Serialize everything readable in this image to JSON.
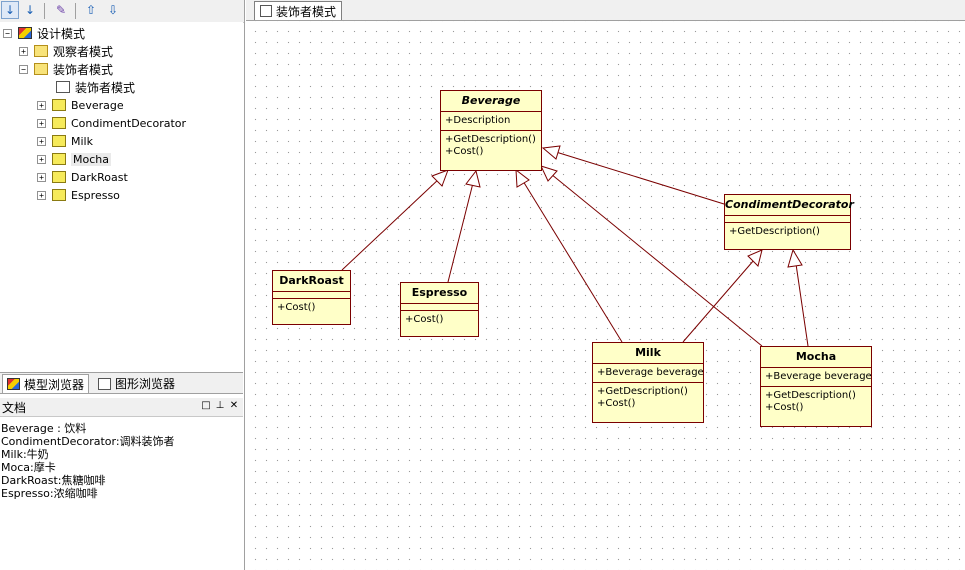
{
  "toolbar": {
    "buttons": [
      "sort-asc-icon",
      "sort-desc-icon",
      "wand-icon",
      "arrow-up-icon",
      "arrow-down-icon"
    ]
  },
  "tree": [
    {
      "label": "设计模式",
      "icon": "model-icon",
      "expander": "−"
    },
    {
      "label": "观察者模式",
      "icon": "package-icon",
      "expander": "+"
    },
    {
      "label": "装饰者模式",
      "icon": "folder-icon",
      "expander": "−"
    },
    {
      "label": "装饰者模式",
      "icon": "diagram-icon",
      "expander": ""
    },
    {
      "label": "Beverage",
      "icon": "class-icon",
      "expander": "+"
    },
    {
      "label": "CondimentDecorator",
      "icon": "class-icon",
      "expander": "+"
    },
    {
      "label": "Milk",
      "icon": "class-icon",
      "expander": "+"
    },
    {
      "label": "Mocha",
      "icon": "class-icon",
      "expander": "+"
    },
    {
      "label": "DarkRoast",
      "icon": "class-icon",
      "expander": "+"
    },
    {
      "label": "Espresso",
      "icon": "class-icon",
      "expander": "+"
    }
  ],
  "left_tabs": [
    {
      "label": "模型浏览器"
    },
    {
      "label": "图形浏览器"
    }
  ],
  "doc_panel": {
    "title": "文档",
    "lines": [
      "Beverage : 饮料",
      "CondimentDecorator:调料装饰者",
      "Milk:牛奶",
      "Moca:摩卡",
      "DarkRoast:焦糖咖啡",
      "Espresso:浓缩咖啡"
    ]
  },
  "diagram_tab": {
    "label": "装饰者模式"
  },
  "classes": {
    "beverage": {
      "name": "Beverage",
      "attrs": [
        "+Description"
      ],
      "methods": [
        "+GetDescription()",
        "+Cost()"
      ]
    },
    "condiment": {
      "name": "CondimentDecorator",
      "attrs": [],
      "methods": [
        "+GetDescription()"
      ]
    },
    "darkroast": {
      "name": "DarkRoast",
      "attrs": [],
      "methods": [
        "+Cost()"
      ]
    },
    "espresso": {
      "name": "Espresso",
      "attrs": [],
      "methods": [
        "+Cost()"
      ]
    },
    "milk": {
      "name": "Milk",
      "attrs": [
        "+Beverage beverage"
      ],
      "methods": [
        "+GetDescription()",
        "+Cost()"
      ]
    },
    "mocha": {
      "name": "Mocha",
      "attrs": [
        "+Beverage beverage"
      ],
      "methods": [
        "+GetDescription()",
        "+Cost()"
      ]
    }
  },
  "colors": {
    "class_fill": "#ffffc8",
    "class_border": "#7a0000",
    "connector": "#7a0000"
  }
}
